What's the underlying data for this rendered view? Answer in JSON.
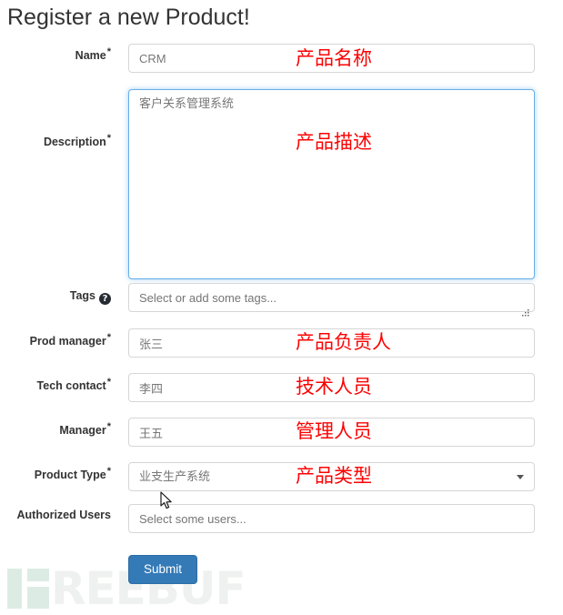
{
  "page": {
    "title": "Register a new Product!",
    "watermark_text": "REEBUF",
    "watermark_color": "#eef1ef",
    "watermark_logo_color": "#dcece4"
  },
  "theme": {
    "accent": "#337ab7",
    "annotation_red": "#fb0303",
    "focus_border": "#66afe9",
    "field_border": "#d6d6d6",
    "label_color": "#333333",
    "placeholder_color": "#adadad"
  },
  "form": {
    "required_marker": "*",
    "fields": [
      {
        "name": "name",
        "label": "Name",
        "required": true,
        "control": "text",
        "value": "CRM",
        "placeholder": "",
        "annotation": "产品名称"
      },
      {
        "name": "description",
        "label": "Description",
        "required": true,
        "control": "textarea",
        "value": "客户关系管理系统",
        "placeholder": "",
        "focused": true,
        "annotation": "产品描述"
      },
      {
        "name": "tags",
        "label": "Tags",
        "required": false,
        "has_help_icon": true,
        "help_icon": "question-mark-circle-icon",
        "control": "text",
        "value": "",
        "placeholder": "Select or add some tags...",
        "annotation": ""
      },
      {
        "name": "prod_manager",
        "label": "Prod manager",
        "required": true,
        "control": "text",
        "value": "张三",
        "placeholder": "",
        "annotation": "产品负责人"
      },
      {
        "name": "tech_contact",
        "label": "Tech contact",
        "required": true,
        "control": "text",
        "value": "李四",
        "placeholder": "",
        "annotation": "技术人员"
      },
      {
        "name": "manager",
        "label": "Manager",
        "required": true,
        "control": "text",
        "value": "王五",
        "placeholder": "",
        "annotation": "管理人员"
      },
      {
        "name": "product_type",
        "label": "Product Type",
        "required": true,
        "control": "select",
        "value": "业支生产系统",
        "placeholder": "",
        "caret_icon": "chevron-down-icon",
        "annotation": "产品类型"
      },
      {
        "name": "authorized_users",
        "label": "Authorized Users",
        "required": false,
        "control": "text",
        "value": "",
        "placeholder": "Select some users...",
        "annotation": ""
      }
    ],
    "submit_label": "Submit"
  }
}
